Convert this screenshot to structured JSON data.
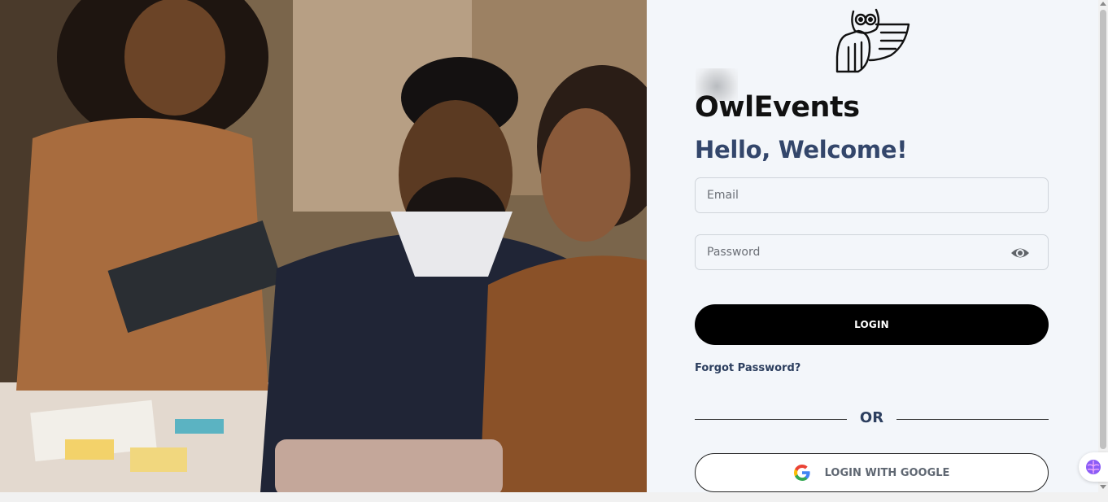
{
  "brand": {
    "name": "OwlEvents"
  },
  "heading": {
    "welcome": "Hello, Welcome!"
  },
  "form": {
    "email_placeholder": "Email",
    "email_value": "",
    "password_placeholder": "Password",
    "password_value": "",
    "login_label": "LOGIN",
    "forgot_label": "Forgot Password?",
    "or_label": "OR",
    "google_label": "LOGIN WITH GOOGLE"
  },
  "icons": {
    "logo": "owl-logo-icon",
    "eye": "eye-icon",
    "google": "google-icon",
    "extension": "brain-extension-icon"
  },
  "colors": {
    "accent": "#33466b",
    "button": "#000000",
    "panel_bg": "#f3f6fa"
  }
}
